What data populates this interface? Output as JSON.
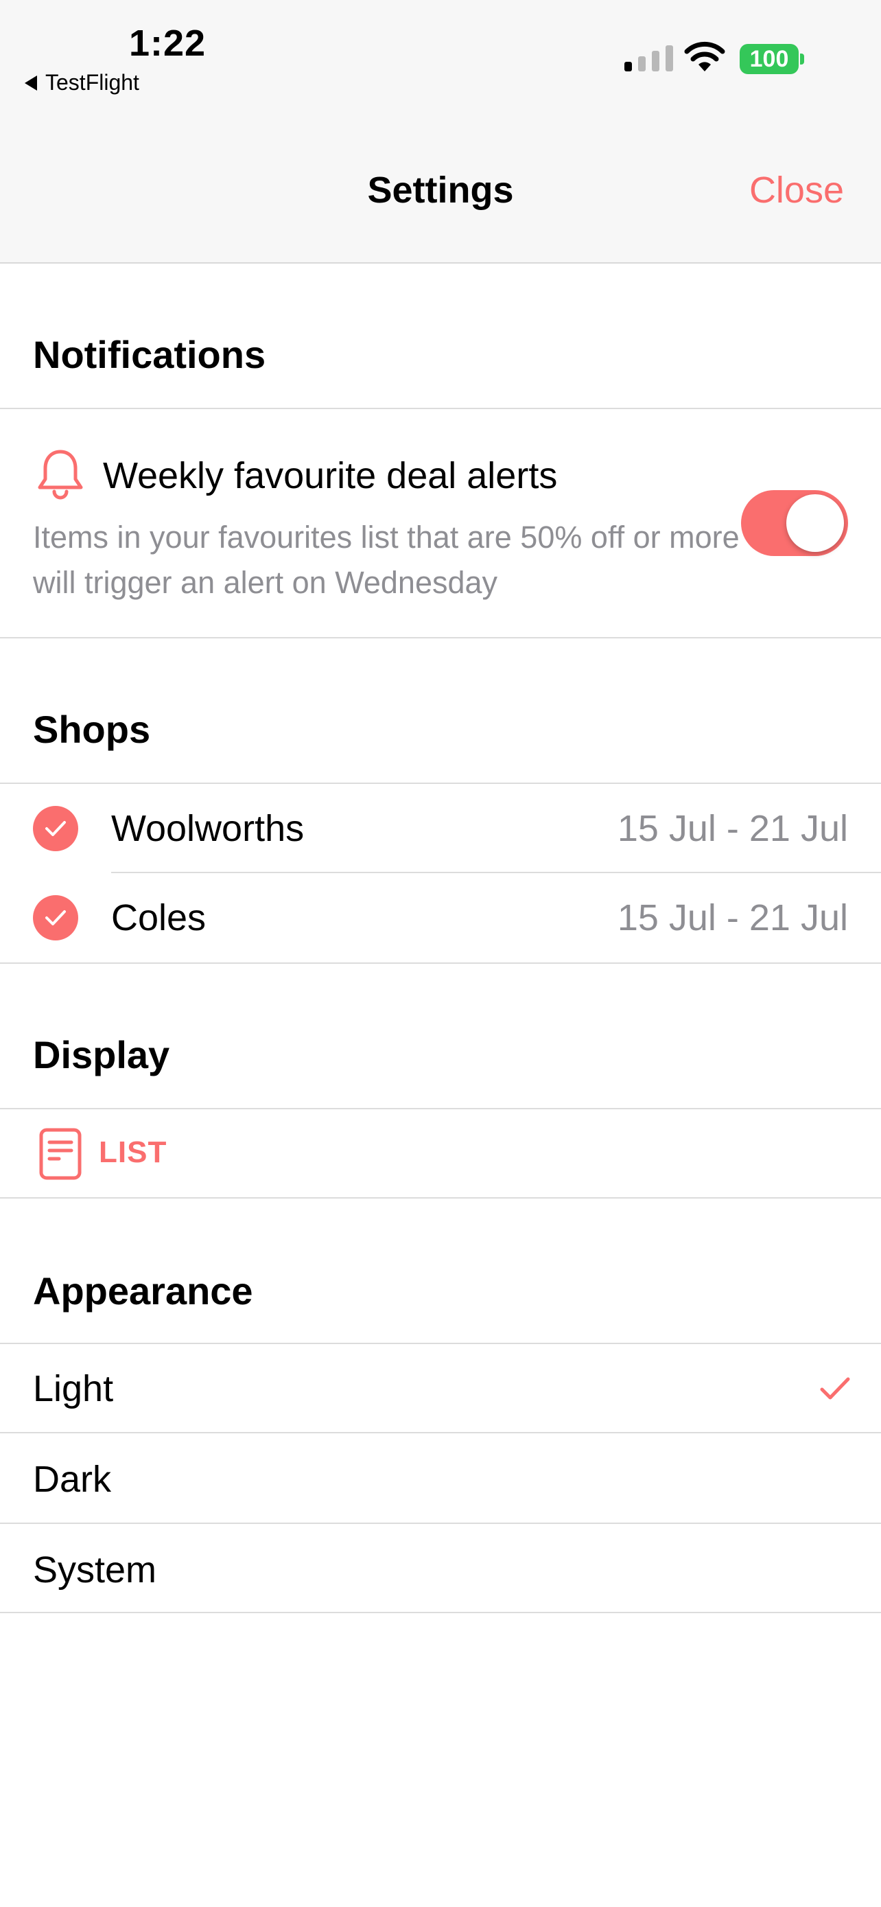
{
  "status_bar": {
    "time": "1:22",
    "back_app": "TestFlight",
    "battery": "100"
  },
  "nav": {
    "title": "Settings",
    "close": "Close"
  },
  "colors": {
    "accent": "#fa6e6e",
    "secondary_text": "#8e8e93",
    "battery": "#34c759"
  },
  "notifications": {
    "header": "Notifications",
    "alert_title": "Weekly favourite deal alerts",
    "alert_description": "Items in your favourites list that are 50% off or more will trigger an alert on Wednesday",
    "toggle_on": true,
    "icon": "bell-icon"
  },
  "shops": {
    "header": "Shops",
    "items": [
      {
        "name": "Woolworths",
        "dates": "15 Jul - 21 Jul",
        "selected": true
      },
      {
        "name": "Coles",
        "dates": "15 Jul - 21 Jul",
        "selected": true
      }
    ]
  },
  "display": {
    "header": "Display",
    "mode_label": "LIST",
    "icon": "document-icon"
  },
  "appearance": {
    "header": "Appearance",
    "options": [
      "Light",
      "Dark",
      "System"
    ],
    "selected": "Light"
  }
}
